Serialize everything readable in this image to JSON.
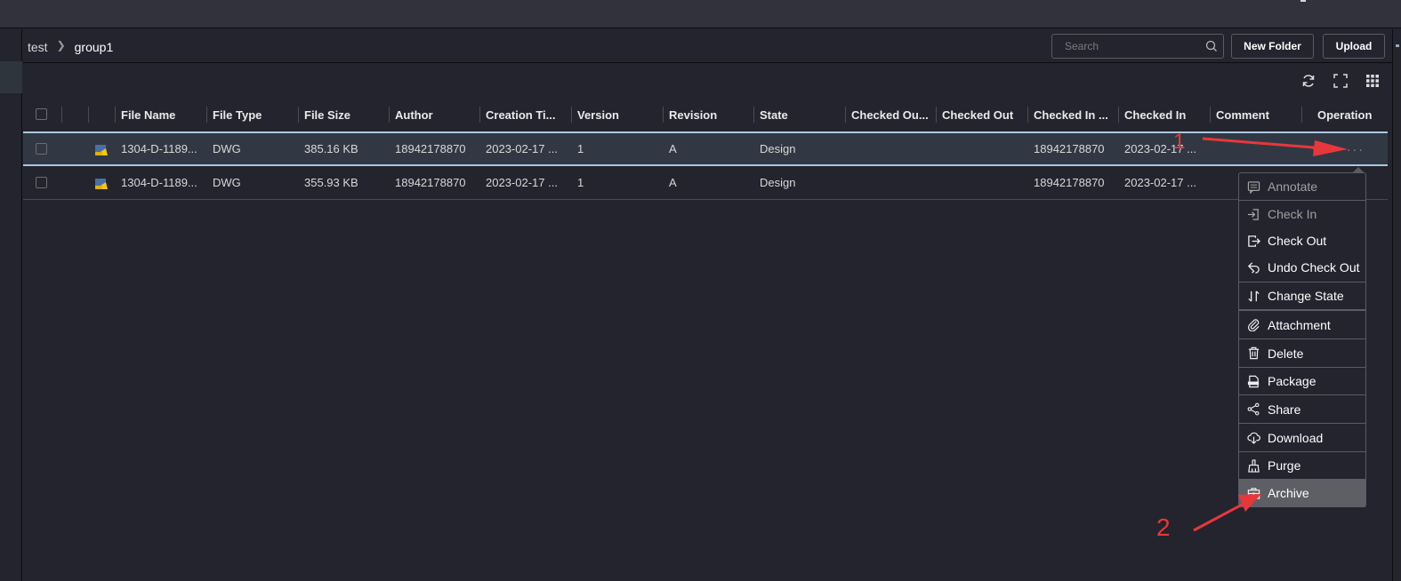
{
  "breadcrumb": {
    "items": [
      "test",
      "group1"
    ]
  },
  "search": {
    "placeholder": "Search",
    "value": ""
  },
  "toolbar": {
    "new_folder_label": "New Folder",
    "upload_label": "Upload"
  },
  "table_tools": {
    "icons": [
      "refresh-icon",
      "fullscreen-icon",
      "grid-icon"
    ]
  },
  "table": {
    "columns": [
      "File Name",
      "File Type",
      "File Size",
      "Author",
      "Creation Ti...",
      "Version",
      "Revision",
      "State",
      "Checked Ou...",
      "Checked Out",
      "Checked In ...",
      "Checked In",
      "Comment",
      "Operation"
    ],
    "rows": [
      {
        "file_name": "1304-D-1189...",
        "file_type": "DWG",
        "file_size": "385.16 KB",
        "author": "18942178870",
        "creation_time": "2023-02-17 ...",
        "version": "1",
        "revision": "A",
        "state": "Design",
        "checked_out_by": "",
        "checked_out": "",
        "checked_in_by": "18942178870",
        "checked_in": "2023-02-17 ...",
        "comment": "",
        "hovered": true
      },
      {
        "file_name": "1304-D-1189...",
        "file_type": "DWG",
        "file_size": "355.93 KB",
        "author": "18942178870",
        "creation_time": "2023-02-17 ...",
        "version": "1",
        "revision": "A",
        "state": "Design",
        "checked_out_by": "",
        "checked_out": "",
        "checked_in_by": "18942178870",
        "checked_in": "2023-02-17 ...",
        "comment": "",
        "hovered": false
      }
    ]
  },
  "operation_menu": {
    "items": [
      {
        "label": "Annotate",
        "icon": "annotate-icon",
        "enabled": false
      },
      {
        "label": "Check In",
        "icon": "check-in-icon",
        "enabled": false
      },
      {
        "label": "Check Out",
        "icon": "check-out-icon",
        "enabled": true
      },
      {
        "label": "Undo Check Out",
        "icon": "undo-check-out-icon",
        "enabled": true
      },
      {
        "label": "Change State",
        "icon": "change-state-icon",
        "enabled": true
      },
      {
        "label": "Attachment",
        "icon": "paperclip-icon",
        "enabled": true
      },
      {
        "label": "Delete",
        "icon": "trash-icon",
        "enabled": true
      },
      {
        "label": "Package",
        "icon": "zip-file-icon",
        "enabled": true
      },
      {
        "label": "Share",
        "icon": "share-icon",
        "enabled": true
      },
      {
        "label": "Download",
        "icon": "cloud-download-icon",
        "enabled": true
      },
      {
        "label": "Purge",
        "icon": "broom-icon",
        "enabled": true
      },
      {
        "label": "Archive",
        "icon": "archive-box-icon",
        "enabled": true,
        "highlighted": true
      }
    ]
  },
  "annotations": {
    "step1": "1",
    "step2": "2",
    "color": "#e8373b"
  },
  "colors": {
    "background": "#23242d",
    "topbar": "#31323c",
    "row_hover": "#313843",
    "row_hover_border": "#a9c8e0",
    "menu_active": "#5e5f64"
  }
}
